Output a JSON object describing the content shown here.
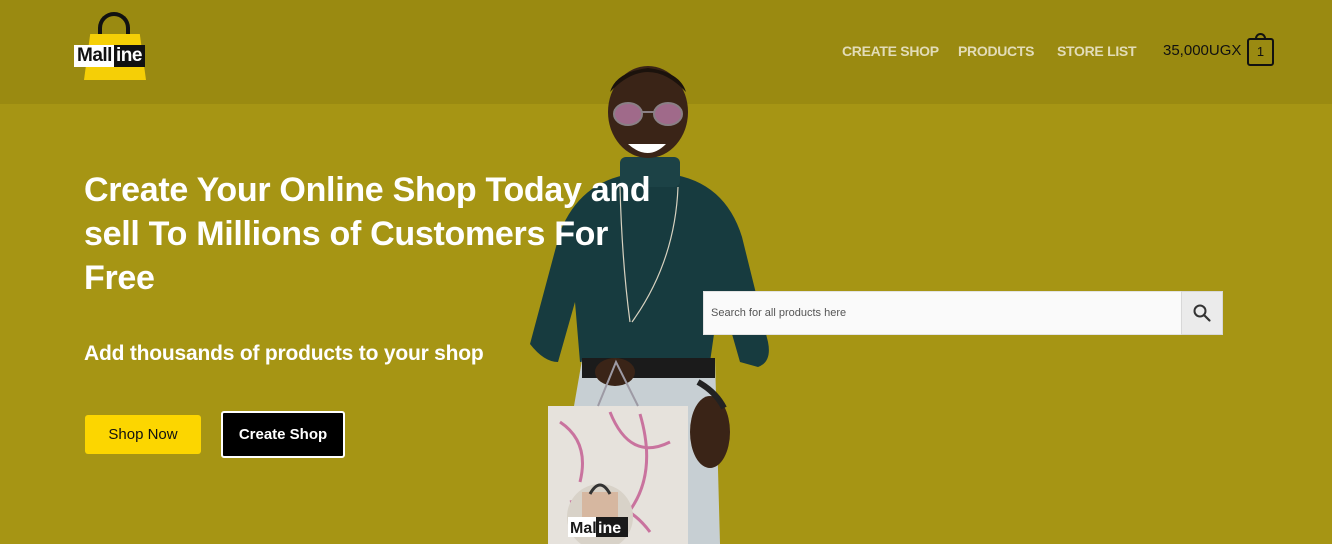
{
  "header": {
    "logo": {
      "part1": "Mall",
      "part2": "ine",
      "icon": "shopping-bag-icon"
    },
    "nav": [
      {
        "label": "CREATE SHOP"
      },
      {
        "label": "PRODUCTS"
      },
      {
        "label": "STORE LIST"
      }
    ],
    "cart": {
      "amount": "35,000UGX",
      "count": "1",
      "icon": "cart-bag-icon"
    }
  },
  "hero": {
    "title": "Create Your Online Shop Today and sell To Millions of Customers For Free",
    "subtitle": "Add thousands of products to your shop",
    "shop_now_label": "Shop Now",
    "create_shop_label": "Create Shop",
    "photo_bag_text": {
      "part1": "Mall",
      "part2": "ine"
    }
  },
  "search": {
    "placeholder": "Search for all products here",
    "value": "",
    "icon": "search-icon"
  },
  "colors": {
    "header_bg": "#9a8a11",
    "hero_bg": "#a69514",
    "accent_yellow": "#fcd600"
  }
}
